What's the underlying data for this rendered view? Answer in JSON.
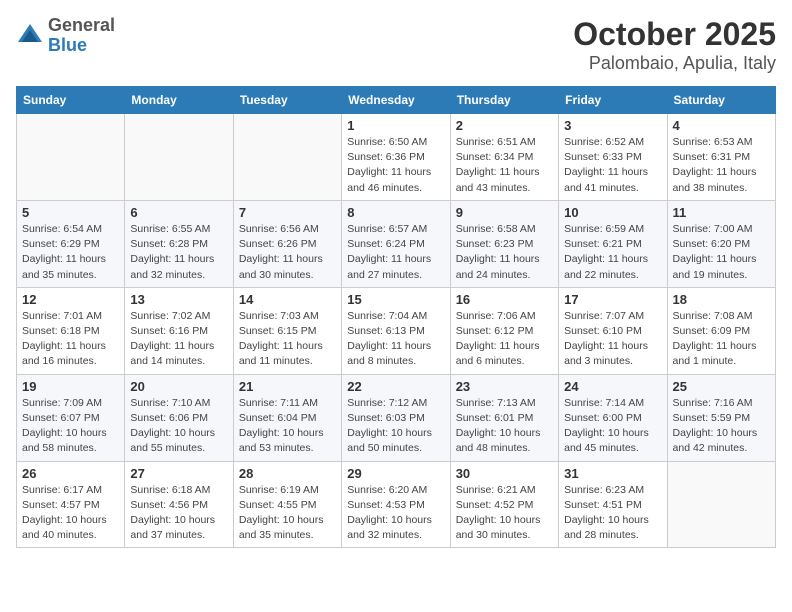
{
  "header": {
    "logo_general": "General",
    "logo_blue": "Blue",
    "title": "October 2025",
    "subtitle": "Palombaio, Apulia, Italy"
  },
  "days_of_week": [
    "Sunday",
    "Monday",
    "Tuesday",
    "Wednesday",
    "Thursday",
    "Friday",
    "Saturday"
  ],
  "weeks": [
    [
      {
        "day": "",
        "info": ""
      },
      {
        "day": "",
        "info": ""
      },
      {
        "day": "",
        "info": ""
      },
      {
        "day": "1",
        "info": "Sunrise: 6:50 AM\nSunset: 6:36 PM\nDaylight: 11 hours\nand 46 minutes."
      },
      {
        "day": "2",
        "info": "Sunrise: 6:51 AM\nSunset: 6:34 PM\nDaylight: 11 hours\nand 43 minutes."
      },
      {
        "day": "3",
        "info": "Sunrise: 6:52 AM\nSunset: 6:33 PM\nDaylight: 11 hours\nand 41 minutes."
      },
      {
        "day": "4",
        "info": "Sunrise: 6:53 AM\nSunset: 6:31 PM\nDaylight: 11 hours\nand 38 minutes."
      }
    ],
    [
      {
        "day": "5",
        "info": "Sunrise: 6:54 AM\nSunset: 6:29 PM\nDaylight: 11 hours\nand 35 minutes."
      },
      {
        "day": "6",
        "info": "Sunrise: 6:55 AM\nSunset: 6:28 PM\nDaylight: 11 hours\nand 32 minutes."
      },
      {
        "day": "7",
        "info": "Sunrise: 6:56 AM\nSunset: 6:26 PM\nDaylight: 11 hours\nand 30 minutes."
      },
      {
        "day": "8",
        "info": "Sunrise: 6:57 AM\nSunset: 6:24 PM\nDaylight: 11 hours\nand 27 minutes."
      },
      {
        "day": "9",
        "info": "Sunrise: 6:58 AM\nSunset: 6:23 PM\nDaylight: 11 hours\nand 24 minutes."
      },
      {
        "day": "10",
        "info": "Sunrise: 6:59 AM\nSunset: 6:21 PM\nDaylight: 11 hours\nand 22 minutes."
      },
      {
        "day": "11",
        "info": "Sunrise: 7:00 AM\nSunset: 6:20 PM\nDaylight: 11 hours\nand 19 minutes."
      }
    ],
    [
      {
        "day": "12",
        "info": "Sunrise: 7:01 AM\nSunset: 6:18 PM\nDaylight: 11 hours\nand 16 minutes."
      },
      {
        "day": "13",
        "info": "Sunrise: 7:02 AM\nSunset: 6:16 PM\nDaylight: 11 hours\nand 14 minutes."
      },
      {
        "day": "14",
        "info": "Sunrise: 7:03 AM\nSunset: 6:15 PM\nDaylight: 11 hours\nand 11 minutes."
      },
      {
        "day": "15",
        "info": "Sunrise: 7:04 AM\nSunset: 6:13 PM\nDaylight: 11 hours\nand 8 minutes."
      },
      {
        "day": "16",
        "info": "Sunrise: 7:06 AM\nSunset: 6:12 PM\nDaylight: 11 hours\nand 6 minutes."
      },
      {
        "day": "17",
        "info": "Sunrise: 7:07 AM\nSunset: 6:10 PM\nDaylight: 11 hours\nand 3 minutes."
      },
      {
        "day": "18",
        "info": "Sunrise: 7:08 AM\nSunset: 6:09 PM\nDaylight: 11 hours\nand 1 minute."
      }
    ],
    [
      {
        "day": "19",
        "info": "Sunrise: 7:09 AM\nSunset: 6:07 PM\nDaylight: 10 hours\nand 58 minutes."
      },
      {
        "day": "20",
        "info": "Sunrise: 7:10 AM\nSunset: 6:06 PM\nDaylight: 10 hours\nand 55 minutes."
      },
      {
        "day": "21",
        "info": "Sunrise: 7:11 AM\nSunset: 6:04 PM\nDaylight: 10 hours\nand 53 minutes."
      },
      {
        "day": "22",
        "info": "Sunrise: 7:12 AM\nSunset: 6:03 PM\nDaylight: 10 hours\nand 50 minutes."
      },
      {
        "day": "23",
        "info": "Sunrise: 7:13 AM\nSunset: 6:01 PM\nDaylight: 10 hours\nand 48 minutes."
      },
      {
        "day": "24",
        "info": "Sunrise: 7:14 AM\nSunset: 6:00 PM\nDaylight: 10 hours\nand 45 minutes."
      },
      {
        "day": "25",
        "info": "Sunrise: 7:16 AM\nSunset: 5:59 PM\nDaylight: 10 hours\nand 42 minutes."
      }
    ],
    [
      {
        "day": "26",
        "info": "Sunrise: 6:17 AM\nSunset: 4:57 PM\nDaylight: 10 hours\nand 40 minutes."
      },
      {
        "day": "27",
        "info": "Sunrise: 6:18 AM\nSunset: 4:56 PM\nDaylight: 10 hours\nand 37 minutes."
      },
      {
        "day": "28",
        "info": "Sunrise: 6:19 AM\nSunset: 4:55 PM\nDaylight: 10 hours\nand 35 minutes."
      },
      {
        "day": "29",
        "info": "Sunrise: 6:20 AM\nSunset: 4:53 PM\nDaylight: 10 hours\nand 32 minutes."
      },
      {
        "day": "30",
        "info": "Sunrise: 6:21 AM\nSunset: 4:52 PM\nDaylight: 10 hours\nand 30 minutes."
      },
      {
        "day": "31",
        "info": "Sunrise: 6:23 AM\nSunset: 4:51 PM\nDaylight: 10 hours\nand 28 minutes."
      },
      {
        "day": "",
        "info": ""
      }
    ]
  ]
}
